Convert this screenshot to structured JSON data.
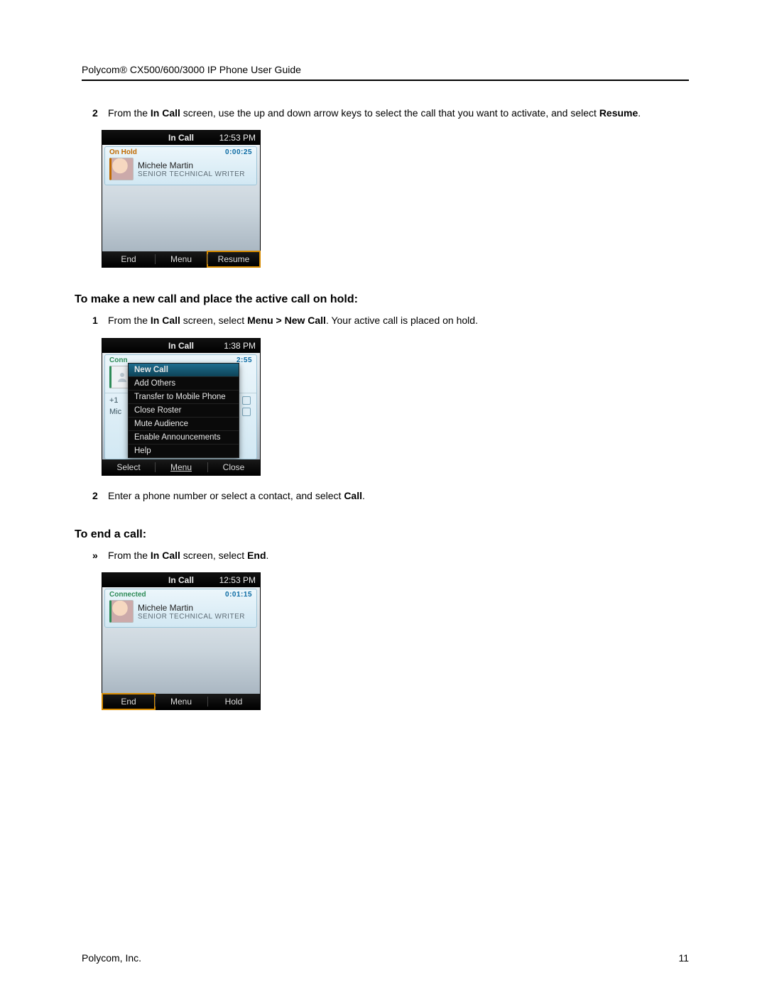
{
  "header": {
    "title": "Polycom® CX500/600/3000 IP Phone User Guide"
  },
  "step_resume": {
    "num": "2",
    "text_parts": [
      "From the ",
      "In Call",
      " screen, use the up and down arrow keys to select the call that you want to activate, and select ",
      "Resume",
      "."
    ]
  },
  "screen1": {
    "title": "In Call",
    "time": "12:53 PM",
    "status": "On Hold",
    "timer": "0:00:25",
    "name": "Michele Martin",
    "role": "SENIOR TECHNICAL WRITER",
    "softkeys": [
      "End",
      "Menu",
      "Resume"
    ]
  },
  "section_newcall_h": "To make a new call and place the active call on hold:",
  "step_menu": {
    "num": "1",
    "text_parts": [
      "From the ",
      "In Call",
      " screen, select ",
      "Menu > New Call",
      ". Your active call is placed on hold."
    ]
  },
  "screen2": {
    "title": "In Call",
    "time": "1:38 PM",
    "left_status": "Conn",
    "timer_frag": "2:55",
    "plus": "+1",
    "mic": "Mic",
    "menu_items": [
      "New Call",
      "Add Others",
      "Transfer to Mobile Phone",
      "Close Roster",
      "Mute Audience",
      "Enable Announcements",
      "Help"
    ],
    "softkeys": [
      "Select",
      "Menu",
      "Close"
    ]
  },
  "step_dial": {
    "num": "2",
    "text_parts": [
      "Enter a phone number or select a contact, and select ",
      "Call",
      "."
    ]
  },
  "section_end_h": "To end a call:",
  "step_end": {
    "bullet": "»",
    "text_parts": [
      "From the ",
      "In Call",
      " screen, select ",
      "End",
      "."
    ]
  },
  "screen3": {
    "title": "In Call",
    "time": "12:53 PM",
    "status": "Connected",
    "timer": "0:01:15",
    "name": "Michele Martin",
    "role": "SENIOR TECHNICAL WRITER",
    "softkeys": [
      "End",
      "Menu",
      "Hold"
    ]
  },
  "footer": {
    "company": "Polycom, Inc.",
    "page": "11"
  }
}
